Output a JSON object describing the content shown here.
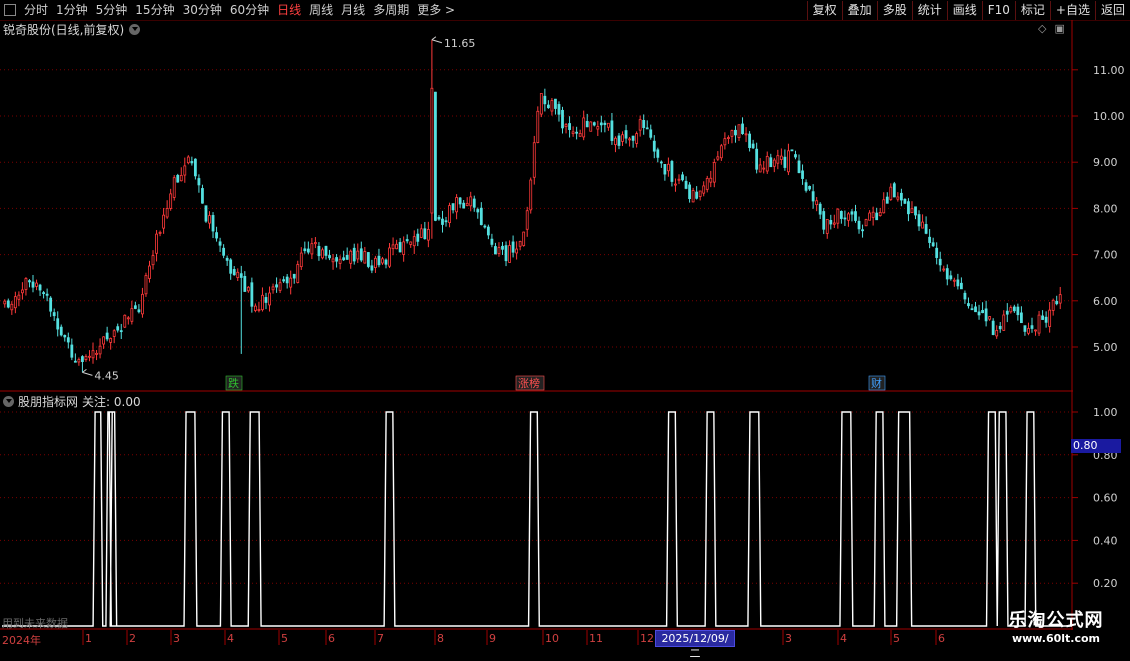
{
  "toolbar": {
    "periods": [
      "分时",
      "1分钟",
      "5分钟",
      "15分钟",
      "30分钟",
      "60分钟",
      "日线",
      "周线",
      "月线",
      "多周期",
      "更多 >"
    ],
    "active_period": "日线",
    "actions": [
      "复权",
      "叠加",
      "多股",
      "统计",
      "画线",
      "F10",
      "标记",
      "+自选",
      "返回"
    ]
  },
  "stock": {
    "title": "锐奇股份(日线,前复权)"
  },
  "price_chart": {
    "y_ticks": [
      "11.00",
      "10.00",
      "9.00",
      "8.00",
      "7.00",
      "6.00",
      "5.00"
    ],
    "high_label": "11.65",
    "low_label": "4.45",
    "event_markers": [
      {
        "text": "跌",
        "color": "#30c030"
      },
      {
        "text": "涨榜",
        "color": "#ff5050"
      },
      {
        "text": "财",
        "color": "#40a0ff"
      }
    ],
    "colors": {
      "up": "#ff3a3a",
      "down": "#54e0e0",
      "grid": "#7a0000"
    }
  },
  "indicator": {
    "title": "股朋指标网",
    "focus_label": "关注: 0.00",
    "y_ticks": [
      "1.00",
      "0.80",
      "0.60",
      "0.40",
      "0.20"
    ],
    "cursor_value": "0.80",
    "future_note": "用到未来数据"
  },
  "date_axis": {
    "year_label": "2024年",
    "months": [
      "1",
      "2",
      "3",
      "4",
      "5",
      "6",
      "7",
      "8",
      "9",
      "10",
      "11",
      "12",
      "3",
      "4",
      "5",
      "6"
    ],
    "cursor_date": "2025/12/09/二"
  },
  "watermark": {
    "title": "乐淘公式网",
    "url": "www.60lt.com"
  },
  "chart_data": [
    {
      "type": "candlestick",
      "title": "锐奇股份(日线,前复权)",
      "ylim": [
        4.45,
        11.65
      ],
      "y_ticks": [
        5,
        6,
        7,
        8,
        9,
        10,
        11
      ],
      "marked_high": 11.65,
      "marked_low": 4.45,
      "close_path": [
        5.9,
        6.3,
        6.5,
        5.6,
        4.9,
        4.6,
        5.2,
        5.5,
        5.8,
        7.2,
        8.6,
        9.0,
        7.9,
        6.9,
        6.5,
        5.9,
        6.2,
        6.4,
        7.2,
        7.0,
        6.9,
        7.0,
        6.8,
        7.0,
        7.3,
        7.5,
        7.7,
        8.2,
        8.1,
        7.2,
        7.0,
        7.4,
        10.5,
        10.0,
        9.6,
        10.0,
        9.7,
        9.4,
        9.8,
        9.1,
        8.6,
        8.3,
        8.6,
        9.4,
        9.8,
        8.9,
        9.0,
        9.1,
        8.4,
        7.6,
        7.9,
        7.6,
        7.9,
        8.4,
        8.0,
        7.5,
        6.8,
        6.2,
        5.8,
        5.4,
        5.8,
        5.3,
        5.6,
        6.2
      ]
    },
    {
      "type": "line",
      "title": "股朋指标网",
      "ylim": [
        0,
        1
      ],
      "y_ticks": [
        0.2,
        0.4,
        0.6,
        0.8,
        1.0
      ],
      "pulses": [
        [
          0.087,
          0.096
        ],
        [
          0.099,
          0.109
        ],
        [
          0.172,
          0.184
        ],
        [
          0.206,
          0.216
        ],
        [
          0.232,
          0.244
        ],
        [
          0.359,
          0.369
        ],
        [
          0.494,
          0.504
        ],
        [
          0.623,
          0.633
        ],
        [
          0.659,
          0.669
        ],
        [
          0.699,
          0.711
        ],
        [
          0.785,
          0.797
        ],
        [
          0.817,
          0.827
        ],
        [
          0.838,
          0.852
        ],
        [
          0.922,
          0.932
        ],
        [
          0.932,
          0.942
        ],
        [
          0.103,
          0.104
        ],
        [
          0.958,
          0.968
        ]
      ]
    }
  ]
}
